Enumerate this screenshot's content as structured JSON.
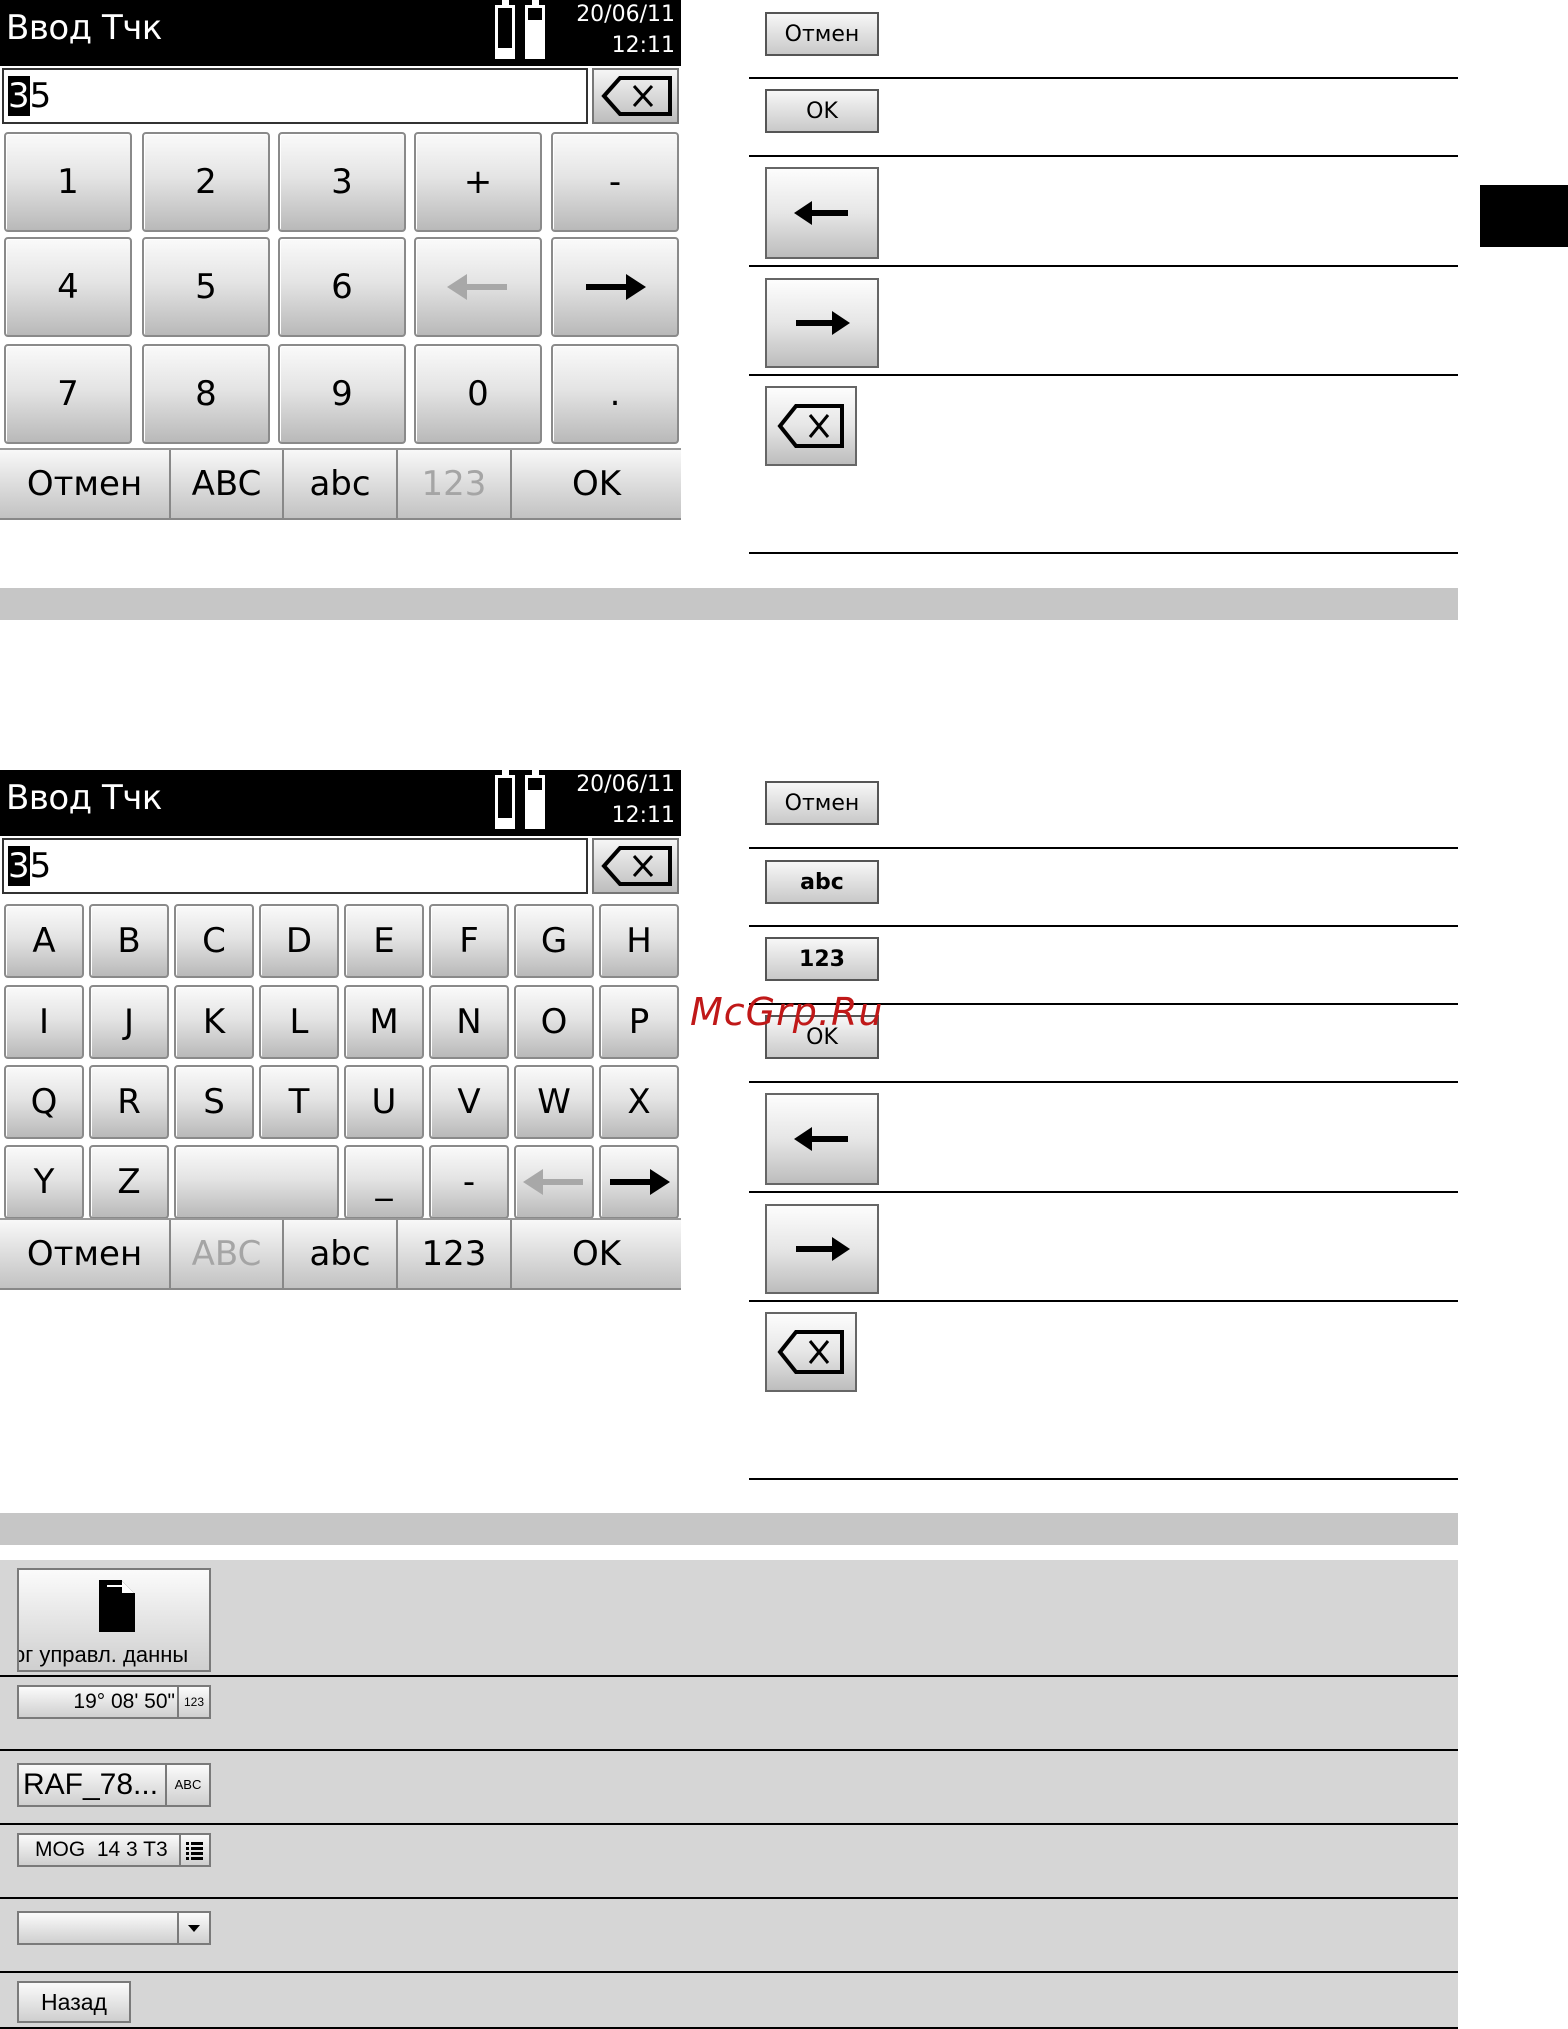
{
  "screen_numeric": {
    "title": "Ввод Тчк",
    "date": "20/06/11",
    "time": "12:11",
    "input_cursor_char": "3",
    "input_rest": "5",
    "keys": [
      "1",
      "2",
      "3",
      "+",
      "-",
      "4",
      "5",
      "6",
      "←",
      "→",
      "7",
      "8",
      "9",
      "0",
      "."
    ],
    "bottom": [
      "Отмен",
      "ABC",
      "abc",
      "123",
      "OK"
    ]
  },
  "legend_numeric": {
    "cancel": "Отмен",
    "ok": "OK"
  },
  "screen_alpha": {
    "title": "Ввод Тчк",
    "date": "20/06/11",
    "time": "12:11",
    "input_cursor_char": "3",
    "input_rest": "5",
    "keys": [
      "A",
      "B",
      "C",
      "D",
      "E",
      "F",
      "G",
      "H",
      "I",
      "J",
      "K",
      "L",
      "M",
      "N",
      "O",
      "P",
      "Q",
      "R",
      "S",
      "T",
      "U",
      "V",
      "W",
      "X",
      "Y",
      "Z",
      "",
      "_",
      "-",
      "←",
      "→"
    ],
    "bottom": [
      "Отмен",
      "ABC",
      "abc",
      "123",
      "OK"
    ]
  },
  "legend_alpha": {
    "cancel": "Отмен",
    "abc": "abc",
    "num": "123",
    "ok": "OK"
  },
  "watermark": "McGrp.Ru",
  "widgets": {
    "data_mgmt_label": "ог управл. данны",
    "angle_value": "19° 08' 50\"",
    "angle_badge": "123",
    "text_value": "RAF_78...",
    "text_badge": "ABC",
    "list_value": "MOG  14 3 T3",
    "back_label": "Назад"
  }
}
